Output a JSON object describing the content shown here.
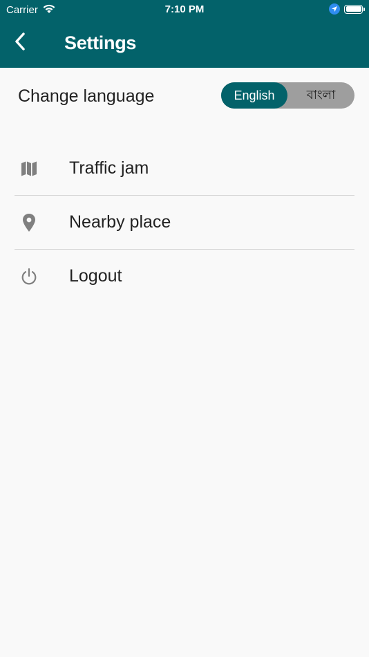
{
  "status_bar": {
    "carrier": "Carrier",
    "time": "7:10 PM"
  },
  "nav": {
    "title": "Settings",
    "back_icon": "chevron-left-icon"
  },
  "language": {
    "label": "Change language",
    "options": [
      "English",
      "বাংলা"
    ],
    "selected": "English"
  },
  "menu": {
    "items": [
      {
        "label": "Traffic jam",
        "icon": "map-icon"
      },
      {
        "label": "Nearby place",
        "icon": "map-pin-icon"
      },
      {
        "label": "Logout",
        "icon": "power-icon"
      }
    ]
  },
  "colors": {
    "primary": "#03626a",
    "toggle_inactive": "#9e9e9e",
    "background": "#f9f9f9",
    "icon_gray": "#808080"
  }
}
